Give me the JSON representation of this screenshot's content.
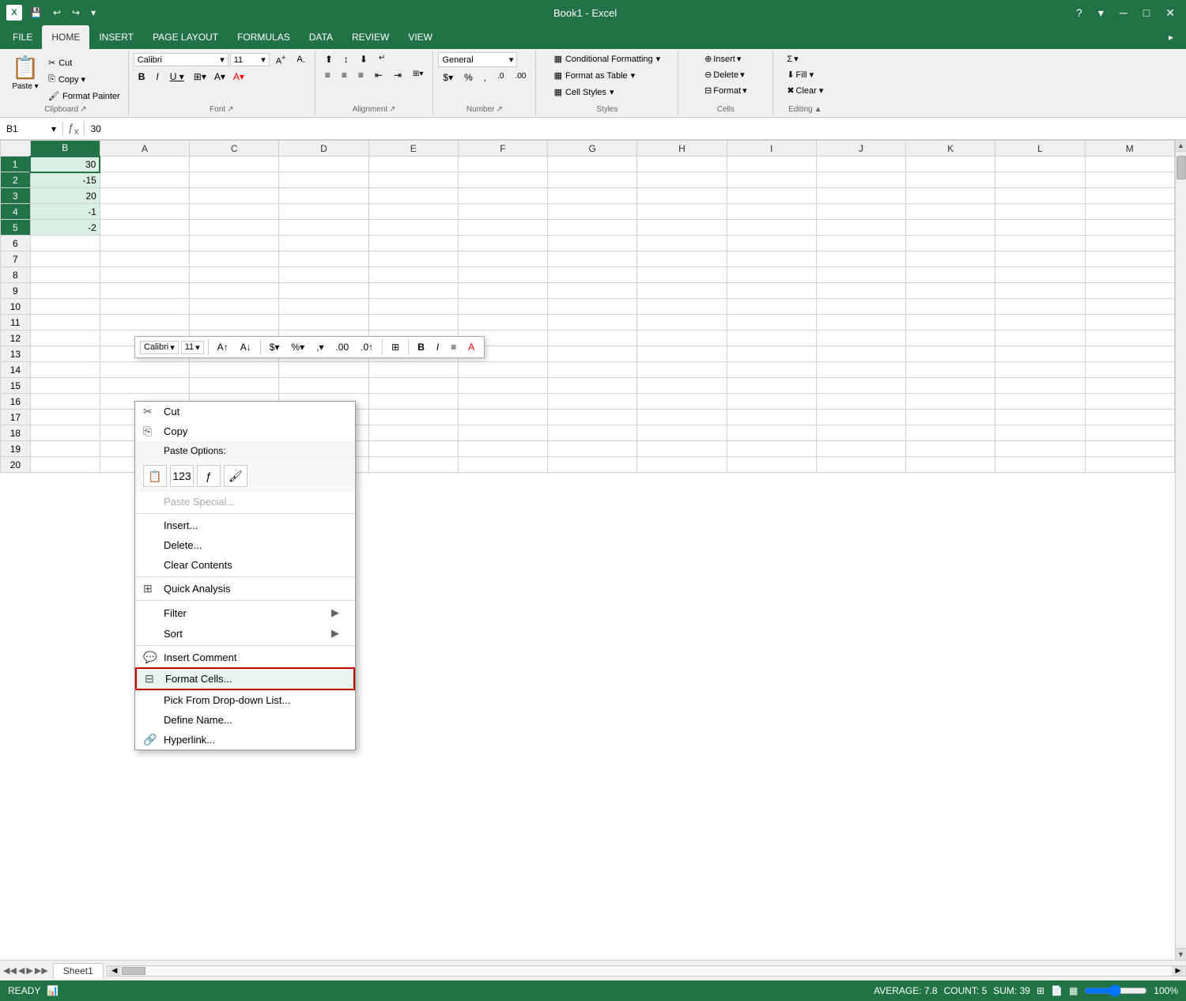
{
  "titleBar": {
    "appName": "Book1 - Excel",
    "saveBtn": "💾",
    "undoBtn": "↩",
    "redoBtn": "↪",
    "helpBtn": "?",
    "minBtn": "─",
    "maxBtn": "□",
    "closeBtn": "✕",
    "moreBtn": "▾"
  },
  "ribbonTabs": [
    "FILE",
    "HOME",
    "INSERT",
    "PAGE LAYOUT",
    "FORMULAS",
    "DATA",
    "REVIEW",
    "VIEW"
  ],
  "activeTab": "HOME",
  "ribbon": {
    "clipboard": {
      "label": "Clipboard",
      "pasteBtn": "Paste",
      "cutBtn": "Cut",
      "copyBtn": "Copy",
      "paintBtn": "Format Painter"
    },
    "font": {
      "label": "Font",
      "fontName": "Calibri",
      "fontSize": "11",
      "boldBtn": "B",
      "italicBtn": "I",
      "underlineBtn": "U",
      "increaseFontBtn": "A↑",
      "decreaseFontBtn": "A↓"
    },
    "alignment": {
      "label": "Alignment"
    },
    "number": {
      "label": "Number",
      "format": "General"
    },
    "styles": {
      "label": "Styles",
      "conditionalFormattingBtn": "Conditional Formatting",
      "formatAsTableBtn": "Format as Table",
      "cellStylesBtn": "Cell Styles"
    },
    "cells": {
      "label": "Cells",
      "insertBtn": "Insert",
      "deleteBtn": "Delete",
      "formatBtn": "Format"
    },
    "editing": {
      "label": "Editing",
      "sumBtn": "Σ",
      "fillBtn": "Fill",
      "clearBtn": "Clear"
    }
  },
  "formulaBar": {
    "nameBox": "B1",
    "formula": "30"
  },
  "grid": {
    "columns": [
      "A",
      "B",
      "C",
      "D",
      "E",
      "F",
      "G",
      "H",
      "I",
      "J",
      "K",
      "L",
      "M"
    ],
    "rows": [
      [
        1,
        "",
        "30",
        "",
        "",
        "",
        "",
        "",
        "",
        "",
        "",
        "",
        "",
        ""
      ],
      [
        2,
        "",
        "-15",
        "",
        "",
        "",
        "",
        "",
        "",
        "",
        "",
        "",
        "",
        ""
      ],
      [
        3,
        "",
        "20",
        "",
        "",
        "",
        "",
        "",
        "",
        "",
        "",
        "",
        "",
        ""
      ],
      [
        4,
        "",
        "-1",
        "",
        "",
        "",
        "",
        "",
        "",
        "",
        "",
        "",
        "",
        ""
      ],
      [
        5,
        "",
        "-2",
        "",
        "",
        "",
        "",
        "",
        "",
        "",
        "",
        "",
        "",
        ""
      ],
      [
        6,
        "",
        "",
        "",
        "",
        "",
        "",
        "",
        "",
        "",
        "",
        "",
        "",
        ""
      ],
      [
        7,
        "",
        "",
        "",
        "",
        "",
        "",
        "",
        "",
        "",
        "",
        "",
        "",
        ""
      ],
      [
        8,
        "",
        "",
        "",
        "",
        "",
        "",
        "",
        "",
        "",
        "",
        "",
        "",
        ""
      ],
      [
        9,
        "",
        "",
        "",
        "",
        "",
        "",
        "",
        "",
        "",
        "",
        "",
        "",
        ""
      ],
      [
        10,
        "",
        "",
        "",
        "",
        "",
        "",
        "",
        "",
        "",
        "",
        "",
        "",
        ""
      ],
      [
        11,
        "",
        "",
        "",
        "",
        "",
        "",
        "",
        "",
        "",
        "",
        "",
        "",
        ""
      ],
      [
        12,
        "",
        "",
        "",
        "",
        "",
        "",
        "",
        "",
        "",
        "",
        "",
        "",
        ""
      ],
      [
        13,
        "",
        "",
        "",
        "",
        "",
        "",
        "",
        "",
        "",
        "",
        "",
        "",
        ""
      ],
      [
        14,
        "",
        "",
        "",
        "",
        "",
        "",
        "",
        "",
        "",
        "",
        "",
        "",
        ""
      ],
      [
        15,
        "",
        "",
        "",
        "",
        "",
        "",
        "",
        "",
        "",
        "",
        "",
        "",
        ""
      ],
      [
        16,
        "",
        "",
        "",
        "",
        "",
        "",
        "",
        "",
        "",
        "",
        "",
        "",
        ""
      ],
      [
        17,
        "",
        "",
        "",
        "",
        "",
        "",
        "",
        "",
        "",
        "",
        "",
        "",
        ""
      ],
      [
        18,
        "",
        "",
        "",
        "",
        "",
        "",
        "",
        "",
        "",
        "",
        "",
        "",
        ""
      ],
      [
        19,
        "",
        "",
        "",
        "",
        "",
        "",
        "",
        "",
        "",
        "",
        "",
        "",
        ""
      ],
      [
        20,
        "",
        "",
        "",
        "",
        "",
        "",
        "",
        "",
        "",
        "",
        "",
        "",
        ""
      ]
    ]
  },
  "miniToolbar": {
    "fontName": "Calibri",
    "fontSize": "11",
    "boldBtn": "B",
    "italicBtn": "I",
    "alignBtn": "≡",
    "currencyBtn": "$",
    "percentBtn": "%",
    "commaBtn": ",",
    "incDecBtn": "↑",
    "tableBtn": "⊞",
    "highlightBtn": "A"
  },
  "contextMenu": {
    "items": [
      {
        "id": "cut",
        "label": "Cut",
        "icon": "✂",
        "hasArrow": false,
        "disabled": false
      },
      {
        "id": "copy",
        "label": "Copy",
        "icon": "⎘",
        "hasArrow": false,
        "disabled": false
      },
      {
        "id": "paste-options",
        "label": "Paste Options:",
        "icon": "",
        "hasArrow": false,
        "isPasteSection": true
      },
      {
        "id": "paste-special",
        "label": "Paste Special...",
        "icon": "",
        "hasArrow": false,
        "disabled": true
      },
      {
        "id": "insert",
        "label": "Insert...",
        "icon": "",
        "hasArrow": false,
        "disabled": false
      },
      {
        "id": "delete",
        "label": "Delete...",
        "icon": "",
        "hasArrow": false,
        "disabled": false
      },
      {
        "id": "clear-contents",
        "label": "Clear Contents",
        "icon": "",
        "hasArrow": false,
        "disabled": false
      },
      {
        "id": "quick-analysis",
        "label": "Quick Analysis",
        "icon": "⊞",
        "hasArrow": false,
        "disabled": false
      },
      {
        "id": "filter",
        "label": "Filter",
        "icon": "",
        "hasArrow": true,
        "disabled": false
      },
      {
        "id": "sort",
        "label": "Sort",
        "icon": "",
        "hasArrow": true,
        "disabled": false
      },
      {
        "id": "insert-comment",
        "label": "Insert Comment",
        "icon": "💬",
        "hasArrow": false,
        "disabled": false
      },
      {
        "id": "format-cells",
        "label": "Format Cells...",
        "icon": "⊟",
        "hasArrow": false,
        "disabled": false,
        "highlighted": true
      },
      {
        "id": "pick-dropdown",
        "label": "Pick From Drop-down List...",
        "icon": "",
        "hasArrow": false,
        "disabled": false
      },
      {
        "id": "define-name",
        "label": "Define Name...",
        "icon": "",
        "hasArrow": false,
        "disabled": false
      },
      {
        "id": "hyperlink",
        "label": "Hyperlink...",
        "icon": "🔗",
        "hasArrow": false,
        "disabled": false
      }
    ]
  },
  "statusBar": {
    "status": "READY",
    "average": "AVERAGE: 7.8",
    "count": "COUNT: 5",
    "sum": "SUM: 39",
    "zoom": "100%"
  },
  "sheetTabs": {
    "tabs": [
      "Sheet1"
    ],
    "activeTab": "Sheet1"
  }
}
